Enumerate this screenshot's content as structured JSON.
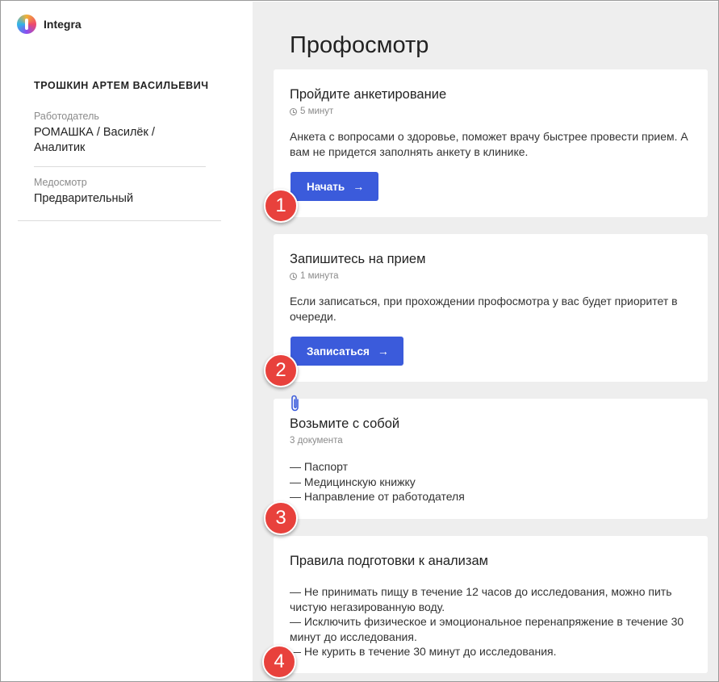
{
  "app": {
    "name": "Integra"
  },
  "sidebar": {
    "user_name": "ТРОШКИН АРТЕМ ВАСИЛЬЕВИЧ",
    "employer_label": "Работодатель",
    "employer_value": "РОМАШКА / Василёк / Аналитик",
    "exam_label": "Медосмотр",
    "exam_value": "Предварительный"
  },
  "main": {
    "title": "Профосмотр",
    "cards": [
      {
        "title": "Пройдите анкетирование",
        "meta": "5 минут",
        "text": "Анкета с вопросами о здоровье, поможет врачу быстрее провести прием. А вам не придется заполнять анкету в клинике.",
        "button": "Начать",
        "arrow": "→"
      },
      {
        "title": "Запишитесь на прием",
        "meta": "1 минута",
        "text": "Если записаться, при прохождении профосмотра у вас будет приоритет в очереди.",
        "button": "Записаться",
        "arrow": "→"
      },
      {
        "title": "Возьмите с собой",
        "meta": "3 документа",
        "items": [
          "— Паспорт",
          "— Медицинскую книжку",
          "— Направление от работодателя"
        ]
      },
      {
        "title": "Правила подготовки к анализам",
        "items": [
          "— Не принимать пищу в течение 12 часов до исследования, можно пить чистую негазированную воду.",
          "— Исключить физическое и эмоциональное перенапряжение в течение 30 минут до исследования.",
          "— Не курить в течение 30 минут до исследования."
        ]
      }
    ]
  },
  "annotations": [
    "1",
    "2",
    "3",
    "4"
  ],
  "colors": {
    "accent": "#3b5bdb",
    "badge": "#e8413c",
    "main_bg": "#eeeeee"
  },
  "icons": {
    "clock": "clock-icon",
    "paperclip": "paperclip-icon",
    "arrow": "arrow-right-icon"
  }
}
